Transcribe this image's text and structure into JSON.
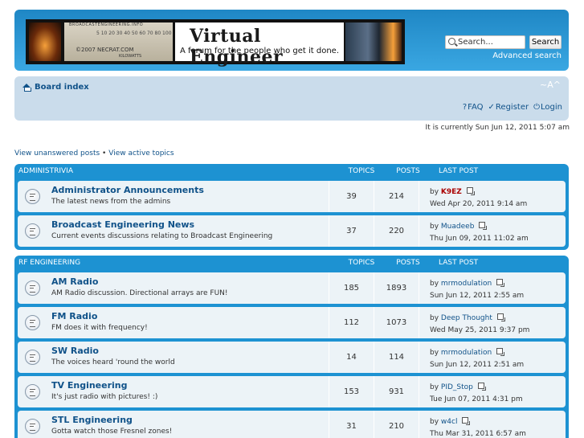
{
  "header": {
    "logo_meter_top": "BROADCASTENGINEERING.INFO",
    "logo_meter_scale": "5  10  20 30 40 50 60 70 80 100",
    "logo_meter_copy": "©2007 NECRAT.COM",
    "logo_meter_sub": "KILOWATTS",
    "site_title": "Virtual Engineer",
    "tagline": "A forum for the people who get it done.",
    "search_placeholder": "Search...",
    "search_button": "Search",
    "advanced_search": "Advanced search"
  },
  "nav": {
    "board_index": "Board index",
    "font_size": "~A^",
    "faq": "FAQ",
    "register": "Register",
    "login": "Login",
    "faq_icon": "question-circle-icon",
    "register_icon": "pencil-check-icon",
    "login_icon": "power-icon"
  },
  "current_time": "It is currently Sun Jun 12, 2011 5:07 am",
  "quick_links": {
    "unanswered": "View unanswered posts",
    "separator": "•",
    "active": "View active topics"
  },
  "columns": {
    "topics": "TOPICS",
    "posts": "POSTS",
    "last_post": "LAST POST"
  },
  "sections": [
    {
      "name": "ADMINISTRIVIA",
      "forums": [
        {
          "title": "Administrator Announcements",
          "desc": "The latest news from the admins",
          "topics": "39",
          "posts": "214",
          "by": "by",
          "author": "K9EZ",
          "author_red": true,
          "date": "Wed Apr 20, 2011 9:14 am"
        },
        {
          "title": "Broadcast Engineering News",
          "desc": "Current events discussions relating to Broadcast Engineering",
          "topics": "37",
          "posts": "220",
          "by": "by",
          "author": "Muadeeb",
          "author_red": false,
          "date": "Thu Jun 09, 2011 11:02 am"
        }
      ]
    },
    {
      "name": "RF ENGINEERING",
      "forums": [
        {
          "title": "AM Radio",
          "desc": "AM Radio discussion. Directional arrays are FUN!",
          "topics": "185",
          "posts": "1893",
          "by": "by",
          "author": "mrmodulation",
          "author_red": false,
          "date": "Sun Jun 12, 2011 2:55 am"
        },
        {
          "title": "FM Radio",
          "desc": "FM does it with frequency!",
          "topics": "112",
          "posts": "1073",
          "by": "by",
          "author": "Deep Thought",
          "author_red": false,
          "date": "Wed May 25, 2011 9:37 pm"
        },
        {
          "title": "SW Radio",
          "desc": "The voices heard 'round the world",
          "topics": "14",
          "posts": "114",
          "by": "by",
          "author": "mrmodulation",
          "author_red": false,
          "date": "Sun Jun 12, 2011 2:51 am"
        },
        {
          "title": "TV Engineering",
          "desc": "It's just radio with pictures! :)",
          "topics": "153",
          "posts": "931",
          "by": "by",
          "author": "PID_Stop",
          "author_red": false,
          "date": "Tue Jun 07, 2011 4:31 pm"
        },
        {
          "title": "STL Engineering",
          "desc": "Gotta watch those Fresnel zones!",
          "topics": "31",
          "posts": "210",
          "by": "by",
          "author": "w4cl",
          "author_red": false,
          "date": "Thu Mar 31, 2011 6:57 am"
        }
      ]
    }
  ],
  "colors": {
    "header_bg": "#1f87c5",
    "nav_bg": "#cadceb",
    "row_bg": "#ecf3f7",
    "link": "#105289",
    "admin_red": "#aa0000"
  }
}
